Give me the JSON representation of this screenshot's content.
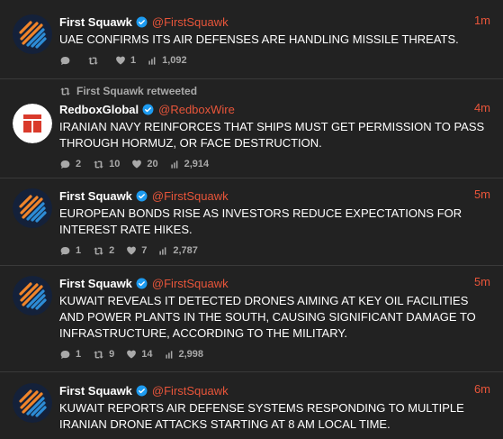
{
  "colors": {
    "background": "#222222",
    "accent": "#e8553a",
    "muted": "#a9a9a9",
    "verified": "#1d9bf0",
    "avatar_fs_bg": "#14213a",
    "avatar_fs_orange": "#f0852a",
    "avatar_fs_blue": "#2d8cd6",
    "avatar_redbox": "#d93a2b"
  },
  "tweets": [
    {
      "name": "First Squawk",
      "handle": "@FirstSquawk",
      "time": "1m",
      "text": "UAE CONFIRMS ITS AIR DEFENSES ARE HANDLING MISSILE THREATS.",
      "replies": "",
      "retweets": "",
      "likes": "1",
      "views": "1,092",
      "avatar_icon": "first-squawk-logo"
    },
    {
      "retweeted_by": "First Squawk retweeted",
      "name": "RedboxGlobal",
      "handle": "@RedboxWire",
      "time": "4m",
      "text": "IRANIAN NAVY REINFORCES THAT SHIPS MUST GET PERMISSION TO PASS THROUGH HORMUZ, OR FACE DESTRUCTION.",
      "replies": "2",
      "retweets": "10",
      "likes": "20",
      "views": "2,914",
      "avatar_icon": "redbox-logo"
    },
    {
      "name": "First Squawk",
      "handle": "@FirstSquawk",
      "time": "5m",
      "text": "EUROPEAN BONDS RISE AS INVESTORS REDUCE EXPECTATIONS FOR INTEREST RATE HIKES.",
      "replies": "1",
      "retweets": "2",
      "likes": "7",
      "views": "2,787",
      "avatar_icon": "first-squawk-logo"
    },
    {
      "name": "First Squawk",
      "handle": "@FirstSquawk",
      "time": "5m",
      "text": "KUWAIT REVEALS IT DETECTED DRONES AIMING AT KEY OIL FACILITIES AND POWER PLANTS IN THE SOUTH, CAUSING SIGNIFICANT DAMAGE TO INFRASTRUCTURE, ACCORDING TO THE MILITARY.",
      "replies": "1",
      "retweets": "9",
      "likes": "14",
      "views": "2,998",
      "avatar_icon": "first-squawk-logo"
    },
    {
      "name": "First Squawk",
      "handle": "@FirstSquawk",
      "time": "6m",
      "text": "KUWAIT REPORTS AIR DEFENSE SYSTEMS RESPONDING TO MULTIPLE IRANIAN DRONE ATTACKS STARTING AT 8 AM LOCAL TIME.",
      "replies": "",
      "retweets": "",
      "likes": "",
      "views": "",
      "avatar_icon": "first-squawk-logo"
    }
  ]
}
